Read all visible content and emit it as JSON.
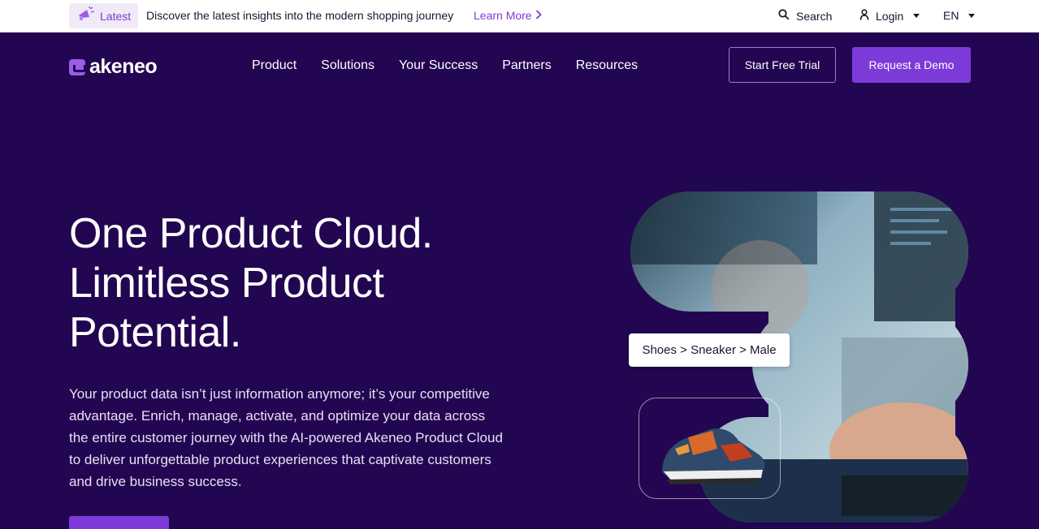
{
  "topbar": {
    "badge_label": "Latest",
    "announcement": "Discover the latest insights into the modern shopping journey",
    "learn_more": "Learn More",
    "search": "Search",
    "login": "Login",
    "language": "EN"
  },
  "header": {
    "logo_text": "akeneo",
    "nav": [
      "Product",
      "Solutions",
      "Your Success",
      "Partners",
      "Resources"
    ],
    "start_trial": "Start Free Trial",
    "request_demo": "Request a Demo"
  },
  "hero": {
    "headline_lines": [
      "One Product Cloud.",
      "Limitless Product",
      "Potential."
    ],
    "subtext": "Your product data isn’t just information anymore; it’s your competitive advantage. Enrich, manage, activate, and optimize your data across the entire customer journey with the AI-powered Akeneo Product Cloud to deliver unforgettable product experiences that captivate customers and drive business success.",
    "breadcrumb": "Shoes > Sneaker > Male"
  },
  "colors": {
    "hero_bg": "#230651",
    "accent": "#7c3bd8",
    "badge_bg": "#efeaf6"
  }
}
